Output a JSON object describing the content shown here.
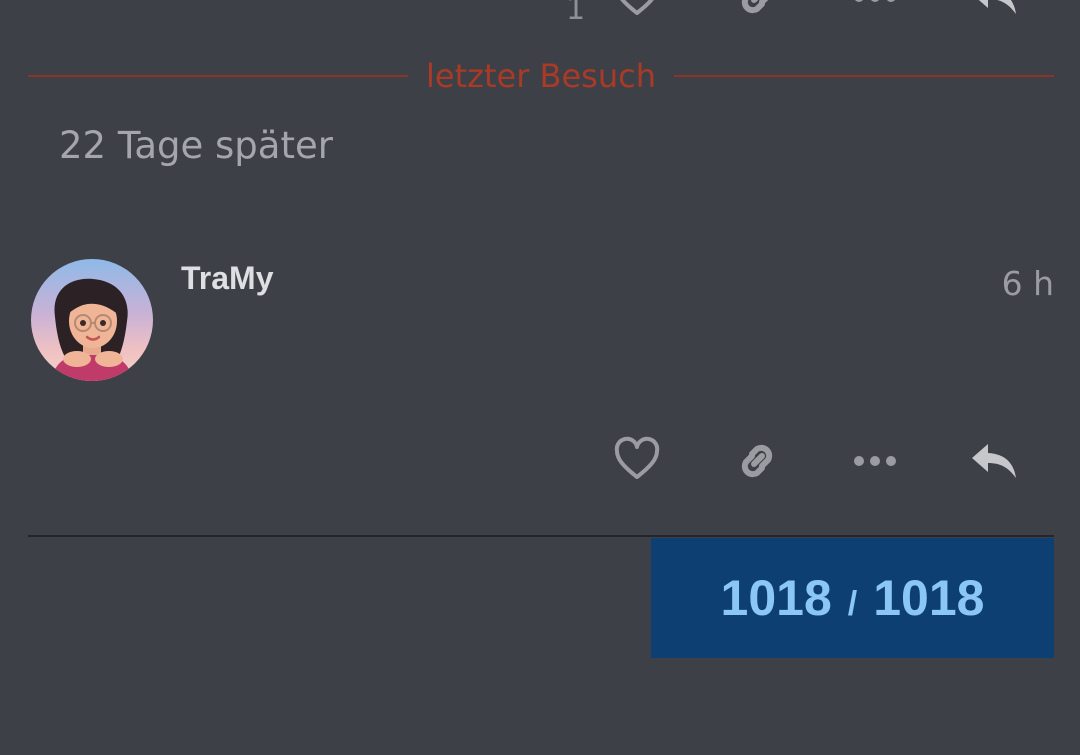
{
  "previous_post": {
    "like_count": "1",
    "icons": [
      "heart-icon",
      "link-icon",
      "more-icon",
      "reply-icon"
    ]
  },
  "divider": {
    "last_visit_label": "letzter Besuch",
    "color": "#a83a26"
  },
  "time_gap": {
    "text": "22 Tage später"
  },
  "post": {
    "username": "TraMy",
    "time": "6 h",
    "icons": [
      "heart-icon",
      "link-icon",
      "more-icon",
      "reply-icon"
    ]
  },
  "progress": {
    "current": "1018",
    "separator": "/",
    "total": "1018",
    "background": "#0e3f73",
    "text_color": "#8ac6f6"
  }
}
